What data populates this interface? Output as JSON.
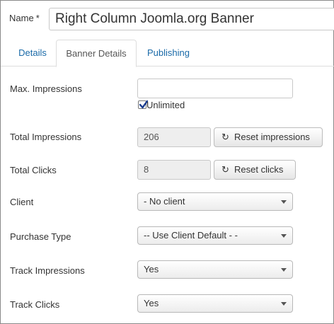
{
  "name_field": {
    "label": "Name",
    "required_mark": "*",
    "value": "Right Column Joomla.org Banner"
  },
  "tabs": [
    {
      "label": "Details",
      "active": false
    },
    {
      "label": "Banner Details",
      "active": true
    },
    {
      "label": "Publishing",
      "active": false
    }
  ],
  "max_impressions": {
    "label": "Max. Impressions",
    "value": "",
    "unlimited_label": "Unlimited",
    "unlimited_checked": true
  },
  "total_impressions": {
    "label": "Total Impressions",
    "value": "206",
    "reset_label": "Reset impressions"
  },
  "total_clicks": {
    "label": "Total Clicks",
    "value": "8",
    "reset_label": "Reset clicks"
  },
  "client": {
    "label": "Client",
    "value": "- No client"
  },
  "purchase_type": {
    "label": "Purchase Type",
    "value": "-- Use Client Default - -"
  },
  "track_impressions": {
    "label": "Track Impressions",
    "value": "Yes"
  },
  "track_clicks": {
    "label": "Track Clicks",
    "value": "Yes"
  },
  "icons": {
    "reset": "refresh-icon",
    "dropdown": "chevron-down-icon",
    "check": "check-icon"
  },
  "colors": {
    "link": "#1a6aa8",
    "readonly_bg": "#eeeeee"
  }
}
